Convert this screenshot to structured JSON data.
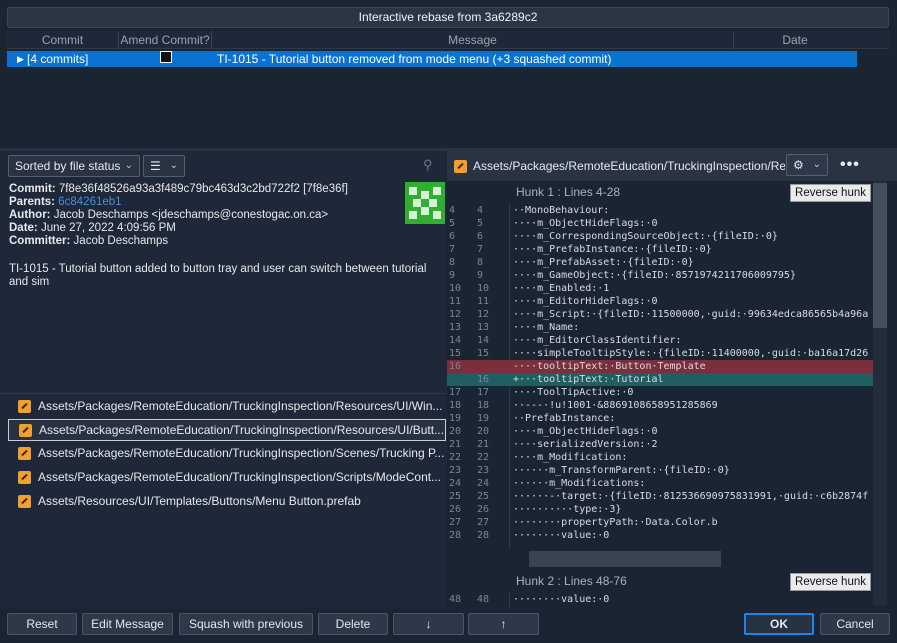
{
  "title": "Interactive rebase from 3a6289c2",
  "columns": [
    "Commit",
    "Amend Commit?",
    "Message",
    "Date"
  ],
  "commit_row": {
    "commit": "[4 commits]",
    "message": "TI-1015 - Tutorial button removed from mode menu (+3 squashed commit)"
  },
  "sort_dropdown": "Sorted by file status",
  "details": {
    "commit_label": "Commit:",
    "commit_value": "7f8e36f48526a93a3f489c79bc463d3c2bd722f2 [7f8e36f]",
    "parents_label": "Parents:",
    "parents_value": "6c84261eb1",
    "author_label": "Author:",
    "author_value": "Jacob Deschamps <jdeschamps@conestogac.on.ca>",
    "date_label": "Date:",
    "date_value": "June 27, 2022 4:09:56 PM",
    "committer_label": "Committer:",
    "committer_value": "Jacob Deschamps",
    "message": "TI-1015 - Tutorial button added to button tray and user can switch between tutorial and sim"
  },
  "files": [
    "Assets/Packages/RemoteEducation/TruckingInspection/Resources/UI/Win...",
    "Assets/Packages/RemoteEducation/TruckingInspection/Resources/UI/Butt...",
    "Assets/Packages/RemoteEducation/TruckingInspection/Scenes/Trucking P...",
    "Assets/Packages/RemoteEducation/TruckingInspection/Scripts/ModeCont...",
    "Assets/Resources/UI/Templates/Buttons/Menu Button.prefab"
  ],
  "diff": {
    "path": "Assets/Packages/RemoteEducation/TruckingInspection/Res...",
    "hunk1_title": "Hunk 1 : Lines 4-28",
    "hunk2_title": "Hunk 2 : Lines 48-76",
    "reverse_label": "Reverse hunk",
    "hunk1_lines": [
      {
        "o": "4",
        "n": "4",
        "t": "··MonoBehaviour:",
        "k": ""
      },
      {
        "o": "5",
        "n": "5",
        "t": "····m_ObjectHideFlags:·0",
        "k": ""
      },
      {
        "o": "6",
        "n": "6",
        "t": "····m_CorrespondingSourceObject:·{fileID:·0}",
        "k": ""
      },
      {
        "o": "7",
        "n": "7",
        "t": "····m_PrefabInstance:·{fileID:·0}",
        "k": ""
      },
      {
        "o": "8",
        "n": "8",
        "t": "····m_PrefabAsset:·{fileID:·0}",
        "k": ""
      },
      {
        "o": "9",
        "n": "9",
        "t": "····m_GameObject:·{fileID:·8571974211706009795}",
        "k": ""
      },
      {
        "o": "10",
        "n": "10",
        "t": "····m_Enabled:·1",
        "k": ""
      },
      {
        "o": "11",
        "n": "11",
        "t": "····m_EditorHideFlags:·0",
        "k": ""
      },
      {
        "o": "12",
        "n": "12",
        "t": "····m_Script:·{fileID:·11500000,·guid:·99634edca86565b4a96a",
        "k": ""
      },
      {
        "o": "13",
        "n": "13",
        "t": "····m_Name:",
        "k": ""
      },
      {
        "o": "14",
        "n": "14",
        "t": "····m_EditorClassIdentifier:",
        "k": ""
      },
      {
        "o": "15",
        "n": "15",
        "t": "····simpleTooltipStyle:·{fileID:·11400000,·guid:·ba16a17d26",
        "k": ""
      },
      {
        "o": "16",
        "n": "",
        "t": "-···tooltipText:·Button·Template",
        "k": "del"
      },
      {
        "o": "",
        "n": "16",
        "t": "+···tooltipText:·Tutorial",
        "k": "add"
      },
      {
        "o": "17",
        "n": "17",
        "t": "····ToolTipActive:·0",
        "k": ""
      },
      {
        "o": "18",
        "n": "18",
        "t": "··---·!u!1001·&8869108658951285869",
        "k": ""
      },
      {
        "o": "19",
        "n": "19",
        "t": "··PrefabInstance:",
        "k": ""
      },
      {
        "o": "20",
        "n": "20",
        "t": "····m_ObjectHideFlags:·0",
        "k": ""
      },
      {
        "o": "21",
        "n": "21",
        "t": "····serializedVersion:·2",
        "k": ""
      },
      {
        "o": "22",
        "n": "22",
        "t": "····m_Modification:",
        "k": ""
      },
      {
        "o": "23",
        "n": "23",
        "t": "······m_TransformParent:·{fileID:·0}",
        "k": ""
      },
      {
        "o": "24",
        "n": "24",
        "t": "······m_Modifications:",
        "k": ""
      },
      {
        "o": "25",
        "n": "25",
        "t": "······-·target:·{fileID:·812536690975831991,·guid:·c6b2874f",
        "k": ""
      },
      {
        "o": "26",
        "n": "26",
        "t": "··········type:·3}",
        "k": ""
      },
      {
        "o": "27",
        "n": "27",
        "t": "········propertyPath:·Data.Color.b",
        "k": ""
      },
      {
        "o": "28",
        "n": "28",
        "t": "········value:·0",
        "k": ""
      }
    ],
    "hunk2_lines": [
      {
        "o": "48",
        "n": "48",
        "t": "········value:·0",
        "k": ""
      }
    ]
  },
  "buttons": {
    "reset": "Reset",
    "edit_message": "Edit Message",
    "squash": "Squash with previous",
    "delete": "Delete",
    "down": "↓",
    "up": "↑",
    "ok": "OK",
    "cancel": "Cancel"
  },
  "colors": {
    "accent": "#0a72cf",
    "deleted_line": "#7a2f3a",
    "added_line": "#1f5f62"
  }
}
